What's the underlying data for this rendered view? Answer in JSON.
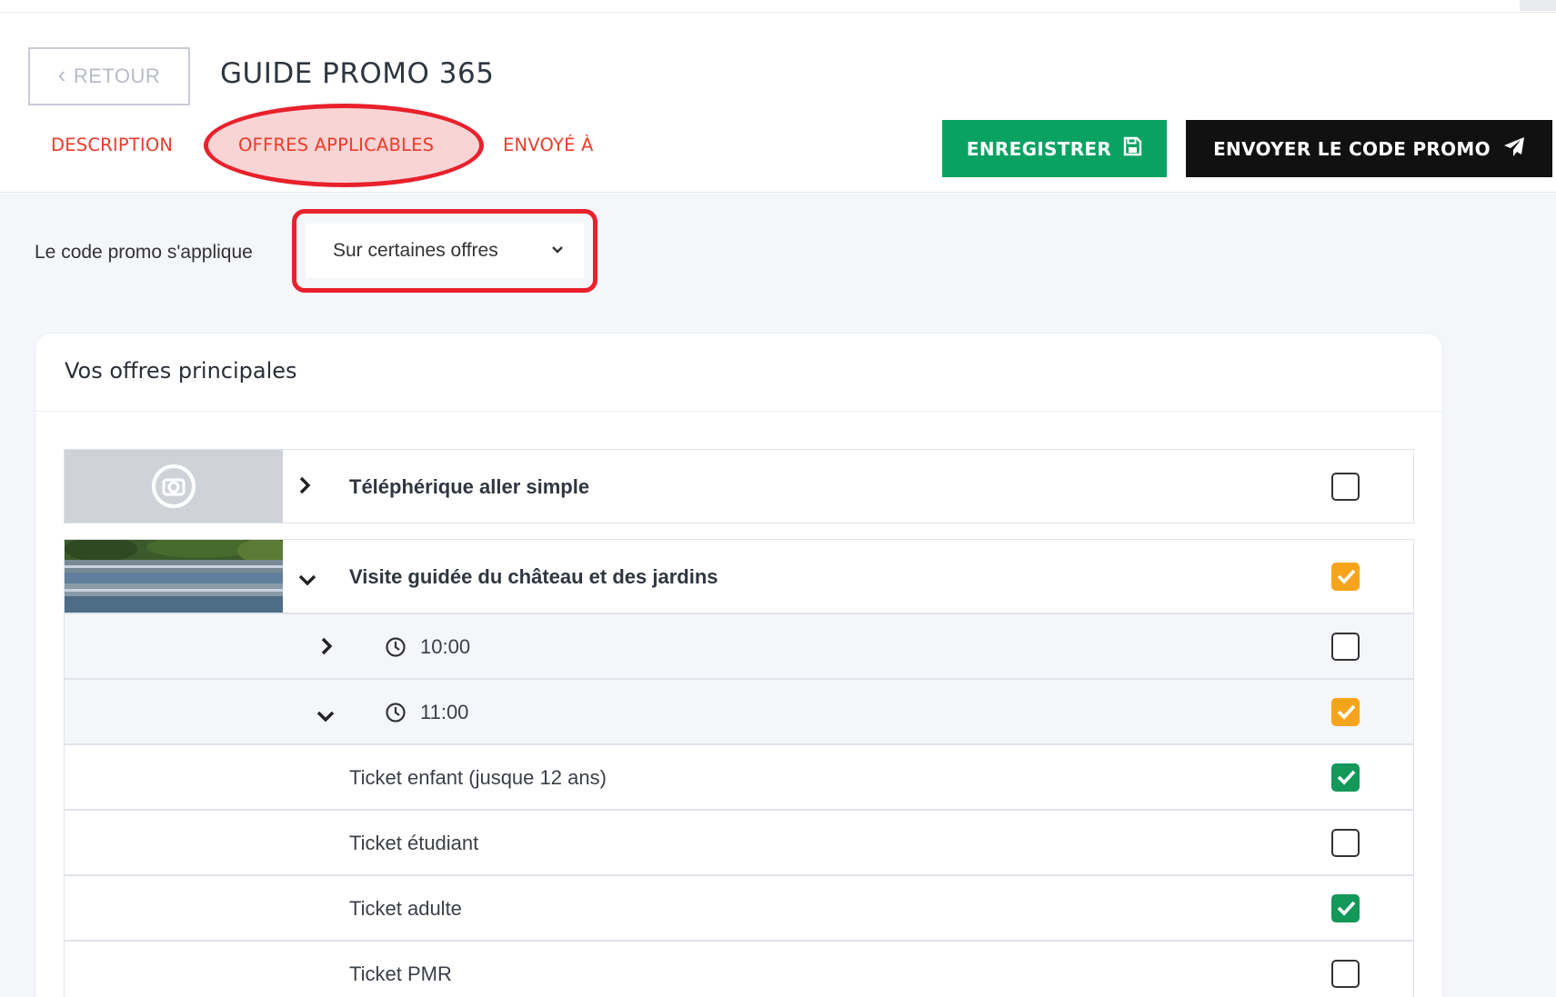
{
  "header": {
    "back_label": "RETOUR",
    "title": "GUIDE PROMO 365",
    "tabs": [
      {
        "label": "DESCRIPTION",
        "active": false
      },
      {
        "label": "OFFRES APPLICABLES",
        "active": true
      },
      {
        "label": "ENVOYÉ À",
        "active": false
      }
    ],
    "save_label": "ENREGISTRER",
    "send_label": "ENVOYER LE CODE PROMO"
  },
  "apply": {
    "label": "Le code promo s'applique",
    "selected": "Sur certaines offres"
  },
  "offers": {
    "title": "Vos offres principales",
    "items": [
      {
        "name": "Téléphérique aller simple",
        "expanded": false,
        "checked": "none"
      },
      {
        "name": "Visite guidée du château et des jardins",
        "expanded": true,
        "checked": "partial",
        "slots": [
          {
            "time": "10:00",
            "expanded": false,
            "checked": "none"
          },
          {
            "time": "11:00",
            "expanded": true,
            "checked": "partial",
            "tickets": [
              {
                "name": "Ticket enfant (jusque 12 ans)",
                "checked": "full"
              },
              {
                "name": "Ticket étudiant",
                "checked": "none"
              },
              {
                "name": "Ticket adulte",
                "checked": "full"
              },
              {
                "name": "Ticket PMR",
                "checked": "none"
              }
            ]
          }
        ]
      }
    ]
  },
  "colors": {
    "tab_text": "#ee3b2b",
    "annotation": "#e8212d",
    "save_bg": "#0aa263",
    "send_bg": "#111111",
    "check_partial": "#f7a41d",
    "check_full": "#13985a"
  },
  "icons": {
    "back": "chevron-left-icon",
    "save": "floppy-disk-icon",
    "send": "paper-plane-icon",
    "placeholder": "camera-icon",
    "collapsed": "chevron-right-icon",
    "expanded": "chevron-down-icon",
    "time": "clock-icon",
    "select": "caret-down-icon"
  }
}
